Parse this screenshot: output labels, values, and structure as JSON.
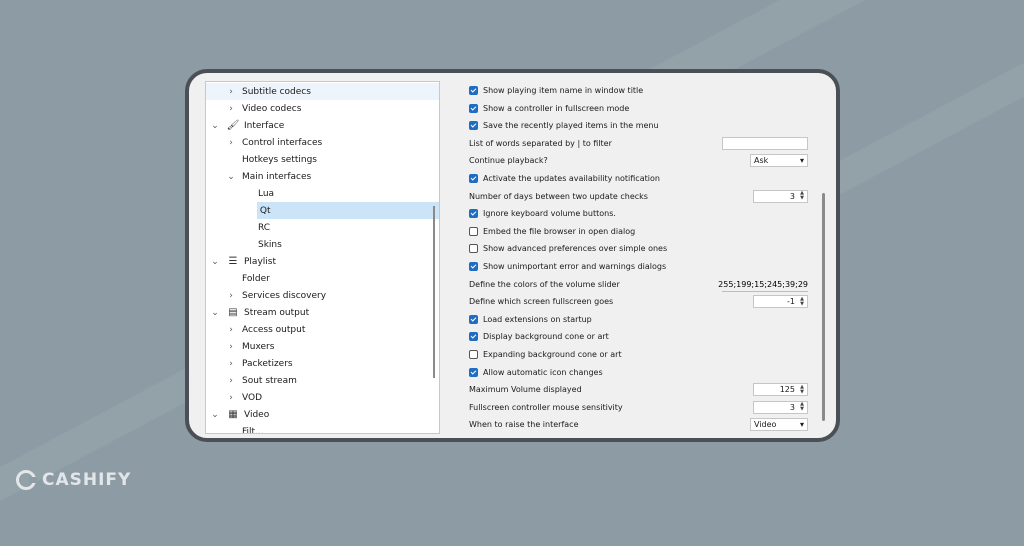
{
  "tree": {
    "items": [
      {
        "label": "Subtitle codecs",
        "chev": "›",
        "level": 1,
        "icon": "",
        "highlight": "light"
      },
      {
        "label": "Video codecs",
        "chev": "›",
        "level": 1,
        "icon": ""
      },
      {
        "label": "Interface",
        "chev": "⌄",
        "level": 0,
        "icon": "paint-roller-icon"
      },
      {
        "label": "Control interfaces",
        "chev": "›",
        "level": 1,
        "icon": ""
      },
      {
        "label": "Hotkeys settings",
        "chev": "",
        "level": 1,
        "icon": ""
      },
      {
        "label": "Main interfaces",
        "chev": "⌄",
        "level": 1,
        "icon": ""
      },
      {
        "label": "Lua",
        "chev": "",
        "level": 2,
        "icon": ""
      },
      {
        "label": "Qt",
        "chev": "",
        "level": 2,
        "icon": "",
        "selected": true
      },
      {
        "label": "RC",
        "chev": "",
        "level": 2,
        "icon": ""
      },
      {
        "label": "Skins",
        "chev": "",
        "level": 2,
        "icon": ""
      },
      {
        "label": "Playlist",
        "chev": "⌄",
        "level": 0,
        "icon": "list-icon"
      },
      {
        "label": "Folder",
        "chev": "",
        "level": 1,
        "icon": ""
      },
      {
        "label": "Services discovery",
        "chev": "›",
        "level": 1,
        "icon": ""
      },
      {
        "label": "Stream output",
        "chev": "⌄",
        "level": 0,
        "icon": "stream-icon"
      },
      {
        "label": "Access output",
        "chev": "›",
        "level": 1,
        "icon": ""
      },
      {
        "label": "Muxers",
        "chev": "›",
        "level": 1,
        "icon": ""
      },
      {
        "label": "Packetizers",
        "chev": "›",
        "level": 1,
        "icon": ""
      },
      {
        "label": "Sout stream",
        "chev": "›",
        "level": 1,
        "icon": ""
      },
      {
        "label": "VOD",
        "chev": "›",
        "level": 1,
        "icon": ""
      },
      {
        "label": "Video",
        "chev": "⌄",
        "level": 0,
        "icon": "film-icon"
      },
      {
        "label": "Filt...",
        "chev": "",
        "level": 1,
        "icon": ""
      }
    ]
  },
  "settings": {
    "rows": [
      {
        "type": "checkbox",
        "checked": true,
        "label": "Show playing item name in window title"
      },
      {
        "type": "checkbox",
        "checked": true,
        "label": "Show a controller in fullscreen mode"
      },
      {
        "type": "checkbox",
        "checked": true,
        "label": "Save the recently played items in the menu"
      },
      {
        "type": "text",
        "label": "List of words separated by | to filter",
        "value": ""
      },
      {
        "type": "combo",
        "label": "Continue playback?",
        "value": "Ask"
      },
      {
        "type": "checkbox",
        "checked": true,
        "label": "Activate the updates availability notification"
      },
      {
        "type": "spin",
        "label": "Number of days between two update checks",
        "value": "3"
      },
      {
        "type": "checkbox",
        "checked": true,
        "label": "Ignore keyboard volume buttons."
      },
      {
        "type": "checkbox",
        "checked": false,
        "label": "Embed the file browser in open dialog"
      },
      {
        "type": "checkbox",
        "checked": false,
        "label": "Show advanced preferences over simple ones"
      },
      {
        "type": "checkbox",
        "checked": true,
        "label": "Show unimportant error and warnings dialogs"
      },
      {
        "type": "textval",
        "label": "Define the colors of the volume slider",
        "value": "255;199;15;245;39;29"
      },
      {
        "type": "spin",
        "label": "Define which screen fullscreen goes",
        "value": "-1"
      },
      {
        "type": "checkbox",
        "checked": true,
        "label": "Load extensions on startup"
      },
      {
        "type": "checkbox",
        "checked": true,
        "label": "Display background cone or art"
      },
      {
        "type": "checkbox",
        "checked": false,
        "label": "Expanding background cone or art"
      },
      {
        "type": "checkbox",
        "checked": true,
        "label": "Allow automatic icon changes"
      },
      {
        "type": "spin",
        "label": "Maximum Volume displayed",
        "value": "125"
      },
      {
        "type": "spin",
        "label": "Fullscreen controller mouse sensitivity",
        "value": "3"
      },
      {
        "type": "combo",
        "label": "When to raise the interface",
        "value": "Video"
      }
    ]
  },
  "watermark": {
    "text": "CASHIFY"
  },
  "colors": {
    "accent": "#1f6dc2",
    "selection": "#cce4f7",
    "background": "#8d9ca4",
    "frame": "#4a5055"
  }
}
